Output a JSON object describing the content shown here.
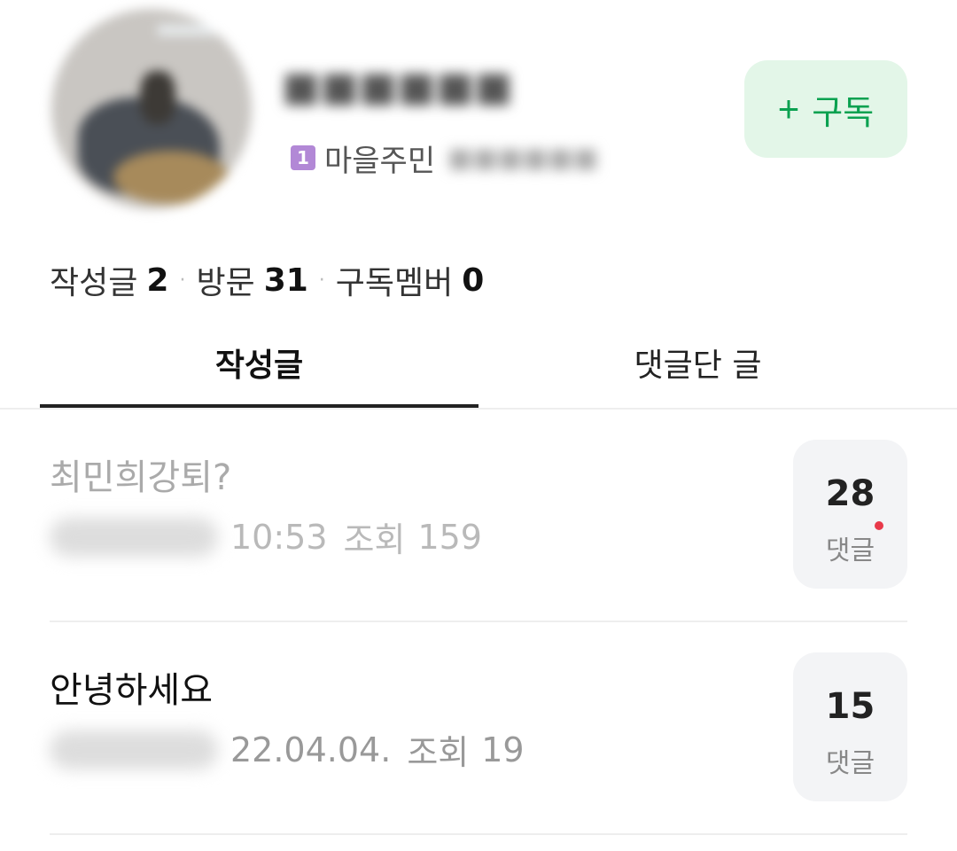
{
  "profile": {
    "grade_badge": "1",
    "grade_label": "마을주민",
    "subscribe_icon": "+",
    "subscribe_label": "구독"
  },
  "stats": {
    "posts_label": "작성글",
    "posts_value": "2",
    "visits_label": "방문",
    "visits_value": "31",
    "subscribers_label": "구독멤버",
    "subscribers_value": "0",
    "separator": "·"
  },
  "tabs": [
    {
      "label": "작성글",
      "active": true
    },
    {
      "label": "댓글단 글",
      "active": false
    }
  ],
  "posts": [
    {
      "title": "최민희강퇴?",
      "time": "10:53",
      "views_label": "조회",
      "views": "159",
      "comment_count": "28",
      "comment_label": "댓글",
      "has_new_comment": true,
      "read": true
    },
    {
      "title": "안녕하세요",
      "time": "22.04.04.",
      "views_label": "조회",
      "views": "19",
      "comment_count": "15",
      "comment_label": "댓글",
      "has_new_comment": false,
      "read": false
    }
  ],
  "colors": {
    "accent_green": "#0aa150",
    "subscribe_bg": "#e3f6e8",
    "grade_badge": "#b288d6",
    "new_dot": "#e8394a"
  }
}
